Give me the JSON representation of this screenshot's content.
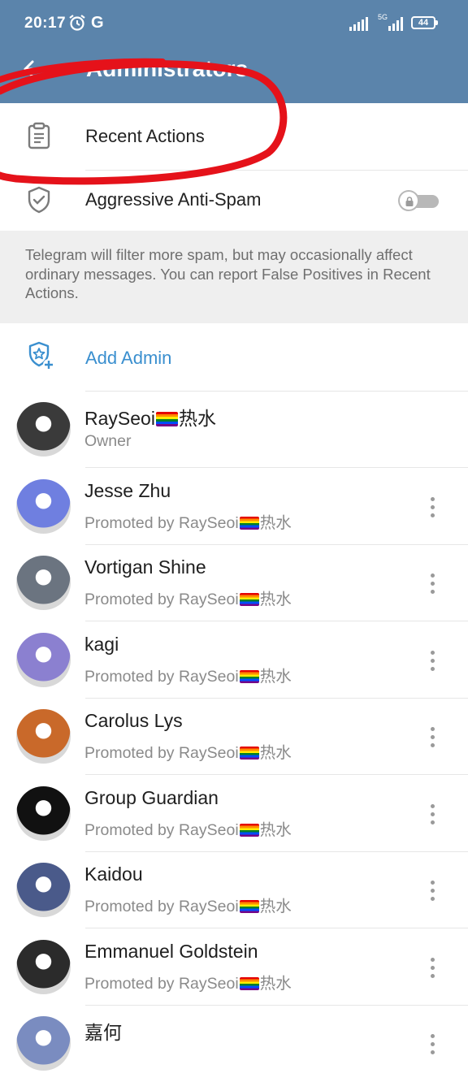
{
  "status_bar": {
    "time": "20:17",
    "carrier_icon": "G",
    "network": "5G",
    "battery": "44"
  },
  "app_bar": {
    "title": "Administrators"
  },
  "settings": {
    "recent_actions_label": "Recent Actions",
    "anti_spam_label": "Aggressive Anti-Spam",
    "anti_spam_enabled": false,
    "anti_spam_locked": true,
    "info_text": "Telegram will filter more spam, but may occasionally affect ordinary messages. You can report False Positives in Recent Actions.",
    "add_admin_label": "Add Admin"
  },
  "admins": [
    {
      "name_a": "RaySeoi",
      "name_b": "热水",
      "flag": true,
      "sub_a": "Owner",
      "sub_b": "",
      "sub_flag": false,
      "menu": false,
      "avatar_color": "#3a3a3a"
    },
    {
      "name_a": "Jesse Zhu",
      "name_b": "",
      "flag": false,
      "sub_a": "Promoted by RaySeoi",
      "sub_b": "热水",
      "sub_flag": true,
      "menu": true,
      "avatar_color": "#6f7fe0"
    },
    {
      "name_a": "Vortigan Shine",
      "name_b": "",
      "flag": false,
      "sub_a": "Promoted by RaySeoi",
      "sub_b": "热水",
      "sub_flag": true,
      "menu": true,
      "avatar_color": "#6b7480"
    },
    {
      "name_a": "kagi",
      "name_b": "",
      "flag": false,
      "sub_a": "Promoted by RaySeoi",
      "sub_b": "热水",
      "sub_flag": true,
      "menu": true,
      "avatar_color": "#8b80d0"
    },
    {
      "name_a": "Carolus Lys",
      "name_b": "",
      "flag": false,
      "sub_a": "Promoted by RaySeoi",
      "sub_b": "热水",
      "sub_flag": true,
      "menu": true,
      "avatar_color": "#c9692a"
    },
    {
      "name_a": "Group Guardian",
      "name_b": "",
      "flag": false,
      "sub_a": "Promoted by RaySeoi",
      "sub_b": "热水",
      "sub_flag": true,
      "menu": true,
      "avatar_color": "#111111"
    },
    {
      "name_a": "Kaidou",
      "name_b": "",
      "flag": false,
      "sub_a": "Promoted by RaySeoi",
      "sub_b": "热水",
      "sub_flag": true,
      "menu": true,
      "avatar_color": "#4a5a8a"
    },
    {
      "name_a": "Emmanuel Goldstein",
      "name_b": "",
      "flag": false,
      "sub_a": "Promoted by RaySeoi",
      "sub_b": "热水",
      "sub_flag": true,
      "menu": true,
      "avatar_color": "#2b2b2b"
    },
    {
      "name_a": "嘉何",
      "name_b": "",
      "flag": false,
      "sub_a": "",
      "sub_b": "",
      "sub_flag": false,
      "menu": true,
      "avatar_color": "#7a8cc0"
    }
  ],
  "colors": {
    "app_bar": "#5b84ab",
    "accent": "#3a8fcf",
    "annotation": "#e5121a"
  }
}
